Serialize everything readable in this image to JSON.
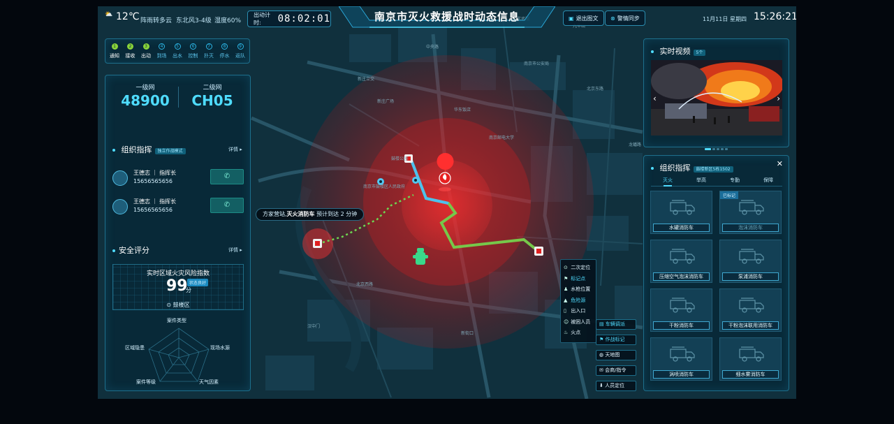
{
  "weather": {
    "temperature": "12℃",
    "condition": "阵雨转多云",
    "wind": "东北风3-4级",
    "humidity": "湿度60%"
  },
  "timer": {
    "label": "出动计时:",
    "value": "08:02:01"
  },
  "title": "南京市灭火救援战时动态信息",
  "top_buttons": {
    "exit": "退出图文",
    "sync": "警情同步"
  },
  "datetime": {
    "date": "11月11日",
    "weekday": "星期四",
    "time": "15:26:21"
  },
  "steps": [
    {
      "num": "1",
      "label": "通知",
      "done": true
    },
    {
      "num": "2",
      "label": "接收",
      "done": true
    },
    {
      "num": "3",
      "label": "出动",
      "done": true
    },
    {
      "num": "4",
      "label": "到场",
      "done": false
    },
    {
      "num": "5",
      "label": "出水",
      "done": false
    },
    {
      "num": "6",
      "label": "控制",
      "done": false
    },
    {
      "num": "7",
      "label": "扑灭",
      "done": false
    },
    {
      "num": "8",
      "label": "停水",
      "done": false
    },
    {
      "num": "9",
      "label": "返队",
      "done": false
    }
  ],
  "networks": [
    {
      "label": "一级网",
      "value": "48900"
    },
    {
      "label": "二级网",
      "value": "CH05"
    }
  ],
  "command": {
    "title": "组织指挥",
    "badge": "独立作战模式",
    "more": "详情 ▸"
  },
  "commanders": [
    {
      "name": "王德志 ｜ 指挥长",
      "phone": "15656565656"
    },
    {
      "name": "王德志 ｜ 指挥长",
      "phone": "15656565656"
    }
  ],
  "safety": {
    "title": "安全评分",
    "more": "详情 ▸",
    "risk_title": "实时区域火灾风险指数",
    "score": "99",
    "unit": "分",
    "status": "状态良好",
    "location": "鼓楼区",
    "axes": [
      "案件类型",
      "现场水源",
      "天气因素",
      "案件等级",
      "区域隐患"
    ]
  },
  "video": {
    "title": "实时视频",
    "count": "5个"
  },
  "org": {
    "title": "组织指挥",
    "badge": "鼓楼新区5栋1502",
    "tabs": [
      "灭火",
      "举高",
      "专勤",
      "保障"
    ],
    "marked_label": "已标记",
    "trucks": [
      "水罐消防车",
      "泡沫消防车",
      "压缩空气泡沫消防车",
      "泵浦消防车",
      "干粉消防车",
      "干粉泡沫联用消防车",
      "涡喷消防车",
      "细水雾消防车"
    ]
  },
  "legend": [
    {
      "icon": "pin",
      "label": "二次定位",
      "hl": false
    },
    {
      "icon": "flag",
      "label": "标记点",
      "hl": true
    },
    {
      "icon": "hydrant",
      "label": "水枪位置",
      "hl": false
    },
    {
      "icon": "warn",
      "label": "危险源",
      "hl": true
    },
    {
      "icon": "door",
      "label": "出入口",
      "hl": false
    },
    {
      "icon": "person",
      "label": "被困人员",
      "hl": false
    },
    {
      "icon": "fire",
      "label": "火点",
      "hl": false
    }
  ],
  "controls": [
    {
      "label": "车辆调派",
      "hl": true
    },
    {
      "label": "作战标记",
      "hl": true
    },
    {
      "label": "天地图",
      "hl": false
    },
    {
      "label": "会商/指令",
      "hl": false
    },
    {
      "label": "人员定位",
      "hl": false
    }
  ],
  "callout": {
    "station": "方家营站,",
    "vehicle": "灭火消防车",
    "eta": " 预计到达 2 分钟"
  },
  "map_labels": [
    "新庄立交",
    "新庄广场",
    "南京市公安局",
    "南京邮电大学",
    "华东饭店",
    "九华山",
    "玄武湖",
    "北京东路",
    "南京市鼓楼区人民政府",
    "鼓楼公园",
    "北京西路",
    "汉中门",
    "龙蟠路",
    "中央路",
    "新街口",
    "南京林业大学"
  ]
}
